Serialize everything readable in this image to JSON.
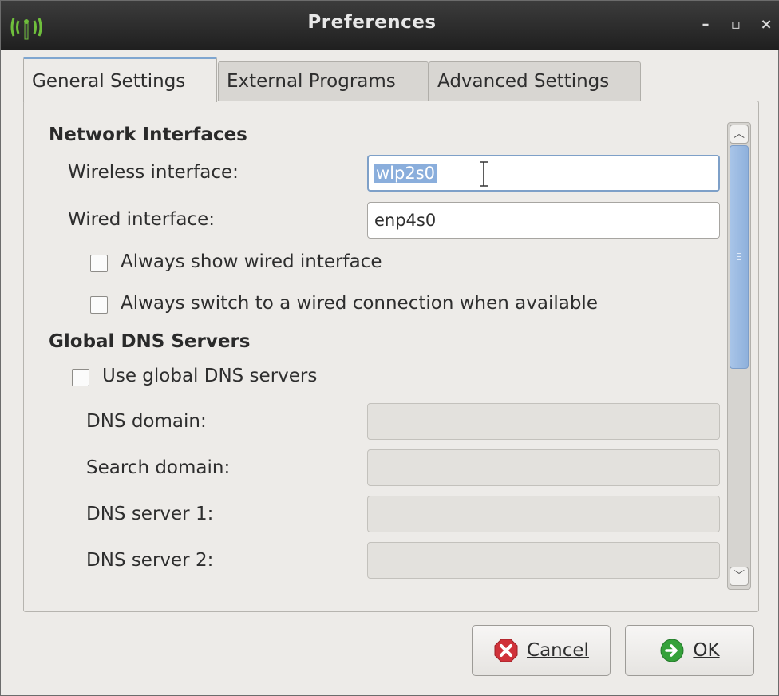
{
  "window": {
    "title": "Preferences"
  },
  "tabs": [
    {
      "label": "General Settings",
      "active": true
    },
    {
      "label": "External Programs",
      "active": false
    },
    {
      "label": "Advanced Settings",
      "active": false
    }
  ],
  "network": {
    "heading": "Network Interfaces",
    "wireless_label": "Wireless interface:",
    "wireless_value": "wlp2s0",
    "wired_label": "Wired interface:",
    "wired_value": "enp4s0",
    "always_show_wired": "Always show wired interface",
    "always_switch_wired": "Always switch to a wired connection when available"
  },
  "dns": {
    "heading": "Global DNS Servers",
    "use_global": "Use global DNS servers",
    "domain_label": "DNS domain:",
    "search_label": "Search domain:",
    "server1_label": "DNS server 1:",
    "server2_label": "DNS server 2:"
  },
  "buttons": {
    "cancel": "Cancel",
    "ok": "OK"
  },
  "colors": {
    "accent": "#8aaedc",
    "cancel_icon": "#d0323a",
    "ok_icon": "#35a13a"
  }
}
